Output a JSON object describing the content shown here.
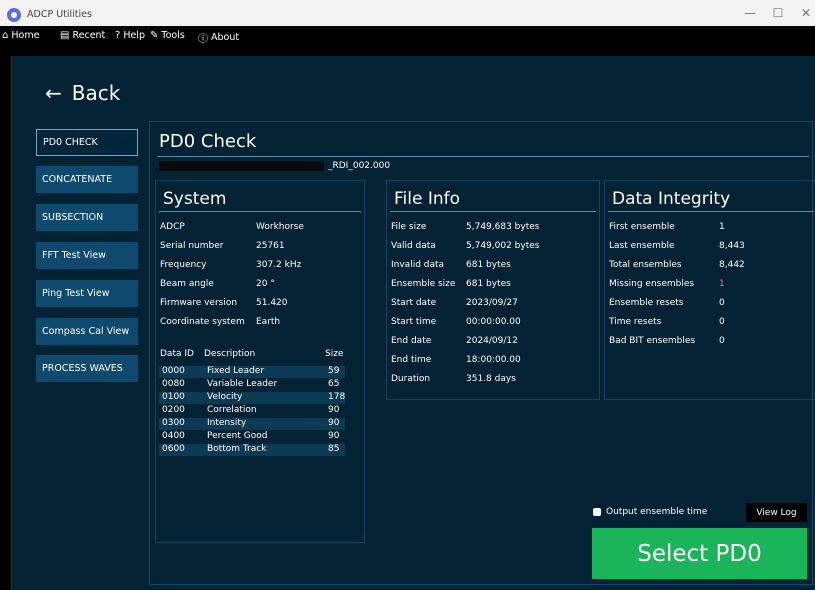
{
  "window": {
    "title": "ADCP Utilities",
    "minimize": "—",
    "maximize": "☐",
    "close": "✕"
  },
  "menu": [
    {
      "icon": "⌂",
      "label": "Home"
    },
    {
      "icon": "▤",
      "label": "Recent"
    },
    {
      "icon": "?",
      "label": "Help"
    },
    {
      "icon": "✎",
      "label": "Tools"
    },
    {
      "icon": "ⓘ",
      "label": "About"
    }
  ],
  "back": {
    "arrow": "←",
    "label": "Back"
  },
  "nav": [
    "PD0 CHECK",
    "CONCATENATE",
    "SUBSECTION",
    "FFT Test View",
    "Ping Test View",
    "Compass Cal View",
    "PROCESS WAVES"
  ],
  "page": {
    "title": "PD0 Check",
    "file_suffix": "_RDI_002.000"
  },
  "system": {
    "title": "System",
    "rows": [
      {
        "k": "ADCP",
        "v": "Workhorse"
      },
      {
        "k": "Serial number",
        "v": "25761"
      },
      {
        "k": "Frequency",
        "v": "307.2 kHz"
      },
      {
        "k": "Beam angle",
        "v": "20 °"
      },
      {
        "k": "Firmware version",
        "v": "51.420"
      },
      {
        "k": "Coordinate system",
        "v": "Earth"
      }
    ]
  },
  "data_table": {
    "headers": {
      "id": "Data ID",
      "desc": "Description",
      "size": "Size"
    },
    "rows": [
      {
        "id": "0000",
        "desc": "Fixed Leader",
        "size": "59"
      },
      {
        "id": "0080",
        "desc": "Variable Leader",
        "size": "65"
      },
      {
        "id": "0100",
        "desc": "Velocity",
        "size": "178"
      },
      {
        "id": "0200",
        "desc": "Correlation",
        "size": "90"
      },
      {
        "id": "0300",
        "desc": "Intensity",
        "size": "90"
      },
      {
        "id": "0400",
        "desc": "Percent Good",
        "size": "90"
      },
      {
        "id": "0600",
        "desc": "Bottom Track",
        "size": "85"
      }
    ]
  },
  "file_info": {
    "title": "File Info",
    "rows": [
      {
        "k": "File size",
        "v": "5,749,683 bytes"
      },
      {
        "k": "Valid data",
        "v": "5,749,002 bytes"
      },
      {
        "k": "Invalid data",
        "v": "681 bytes"
      },
      {
        "k": "Ensemble size",
        "v": "681 bytes"
      },
      {
        "k": "Start date",
        "v": "2023/09/27"
      },
      {
        "k": "Start time",
        "v": "00:00:00.00"
      },
      {
        "k": "End date",
        "v": "2024/09/12"
      },
      {
        "k": "End time",
        "v": "18:00:00.00"
      },
      {
        "k": "Duration",
        "v": "351.8 days"
      }
    ]
  },
  "integrity": {
    "title": "Data Integrity",
    "rows": [
      {
        "k": "First ensemble",
        "v": "1"
      },
      {
        "k": "Last ensemble",
        "v": "8,443"
      },
      {
        "k": "Total ensembles",
        "v": "8,442"
      },
      {
        "k": "Missing ensembles",
        "v": "1"
      },
      {
        "k": "Ensemble resets",
        "v": "0"
      },
      {
        "k": "Time resets",
        "v": "0"
      },
      {
        "k": "Bad BIT ensembles",
        "v": "0"
      }
    ]
  },
  "options": {
    "output_ensemble_time": "Output ensemble time",
    "view_log": "View Log",
    "select": "Select PD0"
  },
  "colors": {
    "background": "#032335",
    "nav_button": "#0d4a6e",
    "select_button": "#1ab45a",
    "warning": "#ff6b6b"
  }
}
